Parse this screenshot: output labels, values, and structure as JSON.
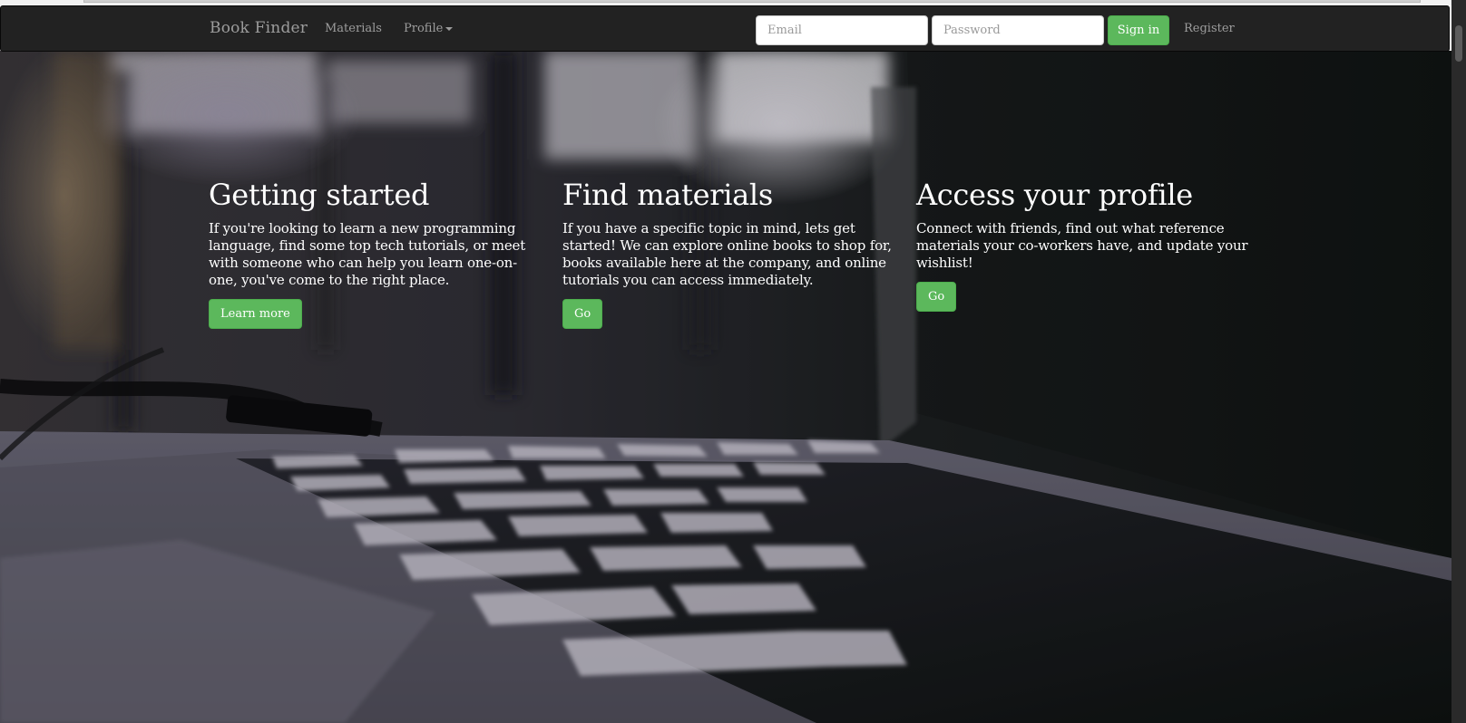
{
  "navbar": {
    "brand": "Book Finder",
    "materials_label": "Materials",
    "profile_label": "Profile",
    "email_placeholder": "Email",
    "password_placeholder": "Password",
    "sign_in_label": "Sign in",
    "register_label": "Register"
  },
  "columns": [
    {
      "title": "Getting started",
      "body": "If you're looking to learn a new programming language, find some top tech tutorials, or meet with someone who can help you learn one-on-one, you've come to the right place.",
      "button": "Learn more"
    },
    {
      "title": "Find materials",
      "body": "If you have a specific topic in mind, lets get started! We can explore online books to shop for, books available here at the company, and online tutorials you can access immediately.",
      "button": "Go"
    },
    {
      "title": "Access your profile",
      "body": "Connect with friends, find out what reference materials your co-workers have, and update your wishlist!",
      "button": "Go"
    }
  ],
  "colors": {
    "navbar_bg": "#222222",
    "nav_text": "#9d9d9d",
    "success_green": "#5cb85c",
    "hero_text": "#ffffff"
  },
  "icons": {
    "profile_dropdown": "caret-down-icon"
  }
}
